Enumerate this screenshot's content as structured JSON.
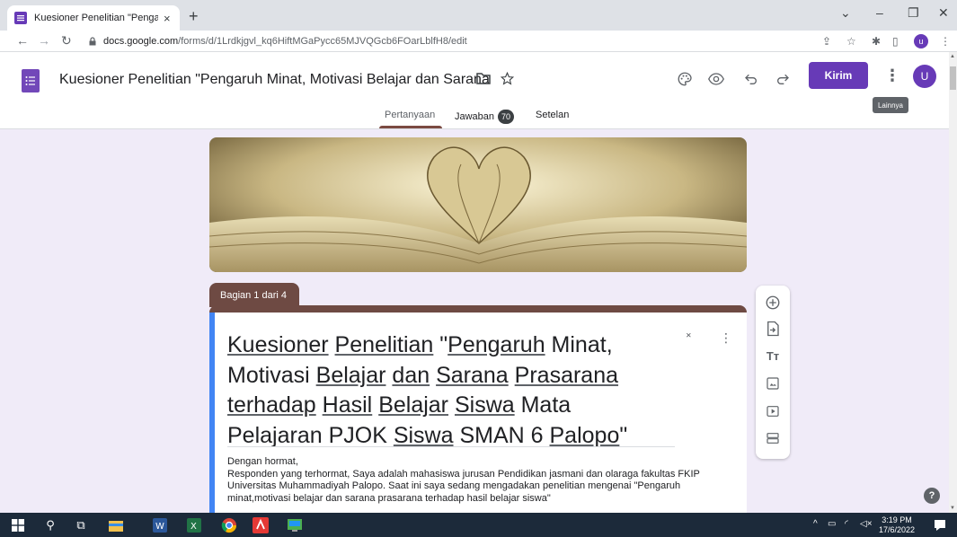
{
  "browser": {
    "tab_title": "Kuesioner Penelitian \"Pengaruh M",
    "tab_close": "×",
    "new_tab": "+",
    "url_host": "docs.google.com",
    "url_path": "/forms/d/1Lrdkjgvl_kq6HiftMGaPycc65MJVQGcb6FOarLblfH8/edit",
    "profile_initial": "u"
  },
  "header": {
    "doc_title": "Kuesioner Penelitian \"Pengaruh Minat, Motivasi Belajar dan Sarana Prasarana",
    "send_label": "Kirim",
    "avatar_initial": "U",
    "tooltip": "Lainnya",
    "tabs": [
      {
        "label": "Pertanyaan"
      },
      {
        "label": "Jawaban",
        "count": "70"
      },
      {
        "label": "Setelan"
      }
    ]
  },
  "section": {
    "label": "Bagian 1 dari 4"
  },
  "form": {
    "title_parts": [
      {
        "text": "Kuesioner",
        "u": true
      },
      {
        "text": " ",
        "u": false
      },
      {
        "text": "Penelitian",
        "u": true
      },
      {
        "text": " \"",
        "u": false
      },
      {
        "text": "Pengaruh",
        "u": true
      },
      {
        "text": " Minat,",
        "u": false
      },
      {
        "text": " Motivasi ",
        "u": false
      },
      {
        "text": "Belajar",
        "u": true
      },
      {
        "text": " ",
        "u": false
      },
      {
        "text": "dan",
        "u": true
      },
      {
        "text": " ",
        "u": false
      },
      {
        "text": "Sarana",
        "u": true
      },
      {
        "text": " ",
        "u": false
      },
      {
        "text": "Prasarana",
        "u": true
      },
      {
        "text": " ",
        "u": false
      },
      {
        "text": "terhadap",
        "u": true
      },
      {
        "text": " ",
        "u": false
      },
      {
        "text": "Hasil",
        "u": true
      },
      {
        "text": " ",
        "u": false
      },
      {
        "text": "Belajar",
        "u": true
      },
      {
        "text": " ",
        "u": false
      },
      {
        "text": "Siswa",
        "u": true
      },
      {
        "text": " Mata Pelajaran PJOK ",
        "u": false
      },
      {
        "text": "Siswa",
        "u": true
      },
      {
        "text": " SMAN 6 ",
        "u": false
      },
      {
        "text": "Palopo",
        "u": true
      },
      {
        "text": "\"",
        "u": false
      }
    ],
    "description_lines": [
      "Dengan hormat,",
      "Responden yang terhormat, Saya adalah mahasiswa jurusan Pendidikan jasmani dan olaraga fakultas FKIP",
      "Universitas Muhammadiyah Palopo. Saat ini saya sedang mengadakan penelitian mengenai \"Pengaruh",
      "minat,motivasi belajar dan sarana prasarana terhadap hasil belajar siswa\""
    ]
  },
  "taskbar": {
    "time": "3:19 PM",
    "date": "17/6/2022"
  },
  "colors": {
    "accent": "#673ab7",
    "section": "#6e4a43",
    "card_border": "#4285f4"
  }
}
